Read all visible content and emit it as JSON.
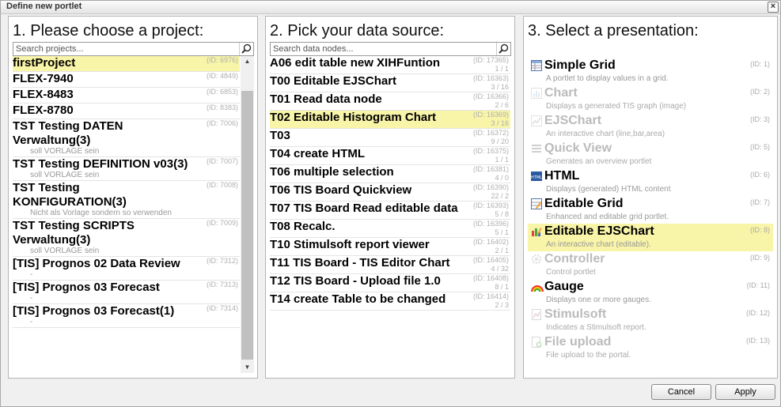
{
  "dialog": {
    "title": "Define new portlet",
    "close": "×"
  },
  "projects": {
    "heading": "1. Please choose a project:",
    "search_placeholder": "Search projects...",
    "items": [
      {
        "name": "firstProject",
        "id": "(ID: 6976)",
        "sub": "",
        "selected": true
      },
      {
        "name": "FLEX-7940",
        "id": "(ID: 4849)",
        "sub": ""
      },
      {
        "name": "FLEX-8483",
        "id": "(ID: 6853)",
        "sub": ""
      },
      {
        "name": "FLEX-8780",
        "id": "(ID: 8383)",
        "sub": ""
      },
      {
        "name": "TST Testing DATEN Verwaltung(3)",
        "id": "(ID: 7006)",
        "sub": "soll VORLAGE sein"
      },
      {
        "name": "TST Testing DEFINITION v03(3)",
        "id": "(ID: 7007)",
        "sub": "soll VORLAGE sein"
      },
      {
        "name": "TST Testing KONFIGURATION(3)",
        "id": "(ID: 7008)",
        "sub": "Nicht als Vorlage sondern so verwenden"
      },
      {
        "name": "TST Testing SCRIPTS Verwaltung(3)",
        "id": "(ID: 7009)",
        "sub": "soll VORLAGE sein"
      },
      {
        "name": "[TIS] Prognos 02 Data Review",
        "id": "(ID: 7312)",
        "sub": "-"
      },
      {
        "name": "[TIS] Prognos 03 Forecast",
        "id": "(ID: 7313)",
        "sub": "-"
      },
      {
        "name": "[TIS] Prognos 03 Forecast(1)",
        "id": "(ID: 7314)",
        "sub": "-"
      }
    ]
  },
  "datasource": {
    "heading": "2. Pick your data source:",
    "search_placeholder": "Search data nodes...",
    "items": [
      {
        "name": "A06 edit table new XIHFuntion",
        "id": "(ID: 17365)",
        "count": "1 / 1"
      },
      {
        "name": "T00 Editable EJSChart",
        "id": "(ID: 16363)",
        "count": "3 / 16"
      },
      {
        "name": "T01 Read data node",
        "id": "(ID: 16366)",
        "count": "2 / 6"
      },
      {
        "name": "T02 Editable Histogram Chart",
        "id": "(ID: 16369)",
        "count": "3 / 16",
        "selected": true
      },
      {
        "name": "T03",
        "id": "(ID: 16372)",
        "count": "9 / 20"
      },
      {
        "name": "T04 create HTML",
        "id": "(ID: 16375)",
        "count": "1 / 1"
      },
      {
        "name": "T06 multiple selection",
        "id": "(ID: 16381)",
        "count": "4 / 0"
      },
      {
        "name": "T06 TIS Board Quickview",
        "id": "(ID: 16390)",
        "count": "22 / 2"
      },
      {
        "name": "T07 TIS Board Read editable data",
        "id": "(ID: 16393)",
        "count": "5 / 8"
      },
      {
        "name": "T08 Recalc.",
        "id": "(ID: 16396)",
        "count": "5 / 1"
      },
      {
        "name": "T10 Stimulsoft report viewer",
        "id": "(ID: 16402)",
        "count": "2 / 1"
      },
      {
        "name": "T11 TIS Board - TIS Editor Chart",
        "id": "(ID: 16405)",
        "count": "4 / 32"
      },
      {
        "name": "T12 TIS Board - Upload file 1.0",
        "id": "(ID: 16408)",
        "count": "8 / 1"
      },
      {
        "name": "T14 create Table to be changed",
        "id": "(ID: 16414)",
        "count": "2 / 3"
      }
    ]
  },
  "presentation": {
    "heading": "3. Select a presentation:",
    "items": [
      {
        "name": "Simple Grid",
        "id": "(ID: 1)",
        "desc": "A portlet to display values in a grid.",
        "icon": "grid-icon",
        "disabled": false
      },
      {
        "name": "Chart",
        "id": "(ID: 2)",
        "desc": "Displays a generated TIS graph (image)",
        "icon": "chart-icon",
        "disabled": true
      },
      {
        "name": "EJSChart",
        "id": "(ID: 3)",
        "desc": "An interactive chart (line,bar,area)",
        "icon": "ejschart-icon",
        "disabled": true
      },
      {
        "name": "Quick View",
        "id": "(ID: 5)",
        "desc": "Generates an overview portlet",
        "icon": "quickview-icon",
        "disabled": true
      },
      {
        "name": "HTML",
        "id": "(ID: 6)",
        "desc": "Displays (generated) HTML content",
        "icon": "html-icon",
        "disabled": false
      },
      {
        "name": "Editable Grid",
        "id": "(ID: 7)",
        "desc": "Enhanced and editable grid portlet.",
        "icon": "editable-grid-icon",
        "disabled": false
      },
      {
        "name": "Editable EJSChart",
        "id": "(ID: 8)",
        "desc": "An interactive chart (editable).",
        "icon": "editable-chart-icon",
        "disabled": false,
        "selected": true
      },
      {
        "name": "Controller",
        "id": "(ID: 9)",
        "desc": "Control portlet",
        "icon": "gear-icon",
        "disabled": true
      },
      {
        "name": "Gauge",
        "id": "(ID: 11)",
        "desc": "Displays one or more gauges.",
        "icon": "rainbow-icon",
        "disabled": false
      },
      {
        "name": "Stimulsoft",
        "id": "(ID: 12)",
        "desc": "Indicates a Stimulsoft report.",
        "icon": "report-icon",
        "disabled": true
      },
      {
        "name": "File upload",
        "id": "(ID: 13)",
        "desc": "File upload to the portal.",
        "icon": "upload-icon",
        "disabled": true
      }
    ]
  },
  "buttons": {
    "cancel": "Cancel",
    "apply": "Apply"
  },
  "colors": {
    "selection": "#f8f4a8",
    "disabled_text": "#bbbbbb"
  }
}
